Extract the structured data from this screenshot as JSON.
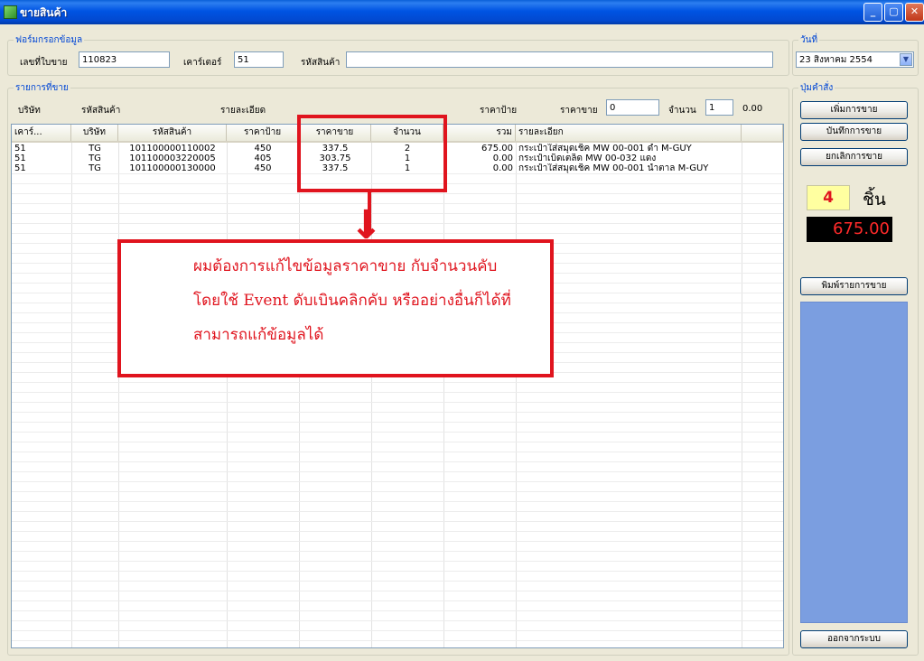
{
  "window": {
    "title": "ขายสินค้า",
    "buttons": {
      "minimize": "_",
      "maximize": "▢",
      "close": "✕"
    }
  },
  "form": {
    "group_label": "ฟอร์มกรอกข้อมูล",
    "invoice_label": "เลขที่ใบขาย",
    "invoice_value": "110823",
    "counter_label": "เคาร์เตอร์",
    "counter_value": "51",
    "product_code_label": "รหัสสินค้า",
    "product_code_value": ""
  },
  "date": {
    "group_label": "วันที่",
    "value": "23  สิงหาคม    2554"
  },
  "items_header": {
    "group_label": "รายการที่ขาย",
    "company_label": "บริษัท",
    "product_label": "รหัสสินค้า",
    "detail_label": "รายละเอียด",
    "tag_price_label": "ราคาป้าย",
    "sell_price_label": "ราคาขาย",
    "sell_price_value": "0",
    "qty_label": "จำนวน",
    "qty_value": "1",
    "amount": "0.00"
  },
  "grid": {
    "columns": [
      "เคาร์...",
      "บริษัท",
      "รหัสสินค้า",
      "ราคาป้าย",
      "ราคาขาย",
      "จำนวน",
      "รวม",
      "รายละเอียก",
      ""
    ],
    "rows": [
      [
        "51",
        "TG",
        "101100000110002",
        "450",
        "337.5",
        "2",
        "675.00",
        "กระเป๋าใส่สมุดเช็ค MW 00-001 ดำ M-GUY"
      ],
      [
        "51",
        "TG",
        "101100003220005",
        "405",
        "303.75",
        "1",
        "0.00",
        "กระเป๋าเบ็ดเตล็ด MW 00-032 แดง"
      ],
      [
        "51",
        "TG",
        "101100000130000",
        "450",
        "337.5",
        "1",
        "0.00",
        "กระเป๋าใส่สมุดเช็ค MW 00-001 น้ำตาล M-GUY"
      ]
    ]
  },
  "commands": {
    "group_label": "ปุ่มคำสั่ง",
    "add_sale": "เพิ่มการขาย",
    "save_sale": "บันทึกการขาย",
    "cancel_sale": "ยกเลิกการขาย",
    "item_count": "4",
    "item_unit": "ชิ้น",
    "total": "675.00",
    "print_list": "พิมพ์รายการขาย",
    "exit": "ออกจากระบบ"
  },
  "annotation": {
    "lines": [
      "ผมต้องการแก้ไขข้อมูลราคาขาย กับจำนวนคับ",
      "โดยใช้ Event ดับเบินคลิกคับ หรืออย่างอื่นก็ได้ที่",
      "สามารถแก้ข้อมูลได้"
    ],
    "arrow": "↓"
  },
  "colors": {
    "title_bar": "#0054e3",
    "group_label": "#0046d5",
    "annotation_red": "#e0141e",
    "count_bg": "#ffffa0",
    "total_bg": "#000000",
    "total_fg": "#ff2a2a",
    "side_panel": "#7b9ee0"
  }
}
